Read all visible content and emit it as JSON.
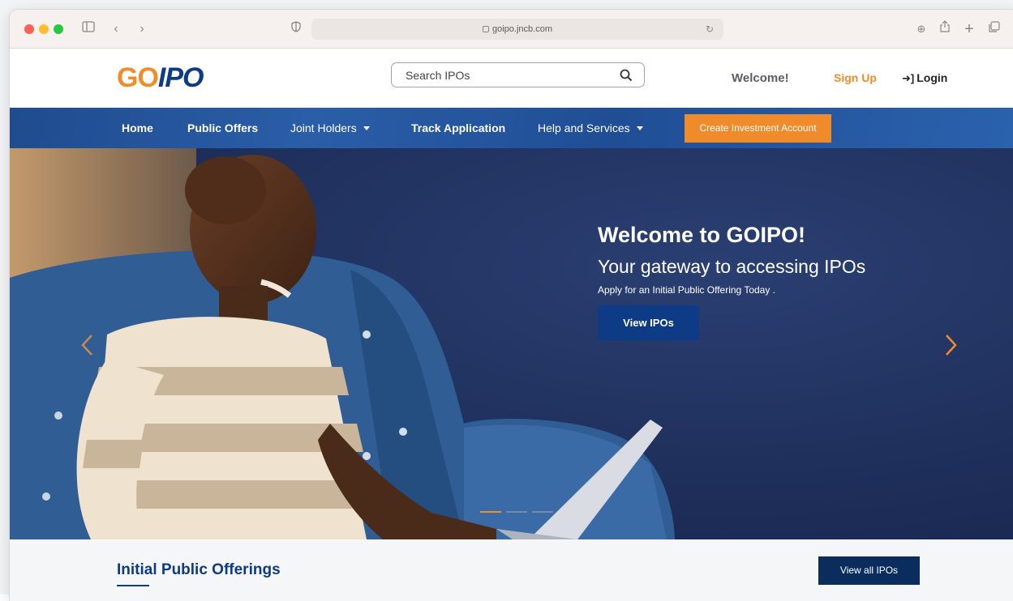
{
  "browser": {
    "url": "goipo.jncb.com"
  },
  "header": {
    "logo_go": "GO",
    "logo_ipo": "IPO",
    "search_placeholder": "Search IPOs",
    "welcome": "Welcome!",
    "signup": "Sign Up",
    "login": "Login"
  },
  "nav": {
    "items": [
      {
        "label": "Home"
      },
      {
        "label": "Public Offers"
      },
      {
        "label": "Joint Holders"
      },
      {
        "label": "Track Application"
      },
      {
        "label": "Help and Services"
      }
    ],
    "cta": "Create Investment Account"
  },
  "hero": {
    "title": "Welcome to GOIPO!",
    "subtitle": "Your gateway to accessing IPOs",
    "tagline": "Apply for an Initial Public Offering Today .",
    "button": "View IPOs",
    "slide_count": 3,
    "active_slide": 1
  },
  "section": {
    "title": "Initial Public Offerings",
    "view_all": "View all IPOs"
  },
  "colors": {
    "brand_orange": "#f28c28",
    "brand_blue": "#0d3b86",
    "nav_blue": "#1f4b8f"
  }
}
